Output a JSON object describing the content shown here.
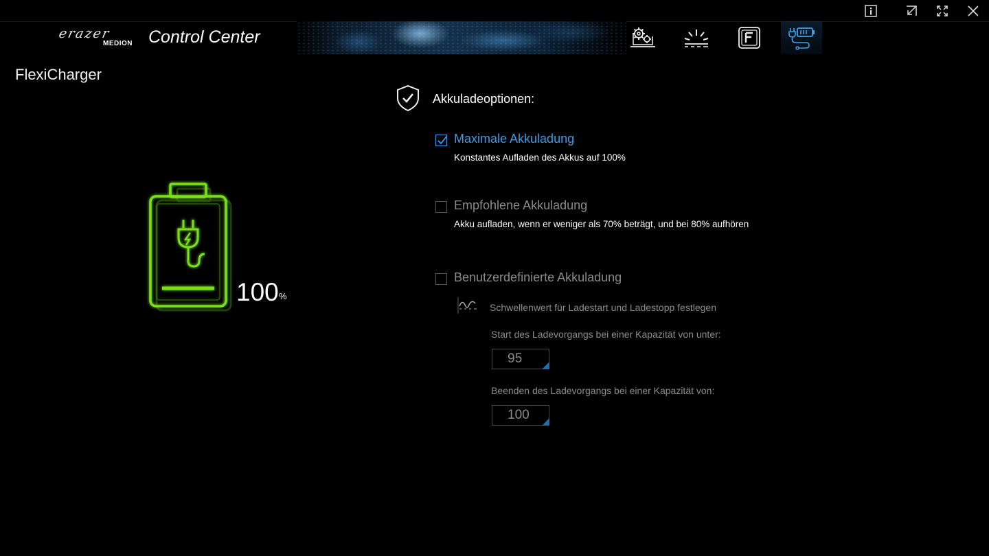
{
  "window": {
    "controls": [
      {
        "name": "info",
        "icon": "info-icon"
      },
      {
        "name": "restore",
        "icon": "shrink-icon"
      },
      {
        "name": "fullscreen",
        "icon": "fullscreen-icon"
      },
      {
        "name": "close",
        "icon": "close-icon"
      }
    ]
  },
  "header": {
    "logo_text": "erazer",
    "logo_sub": "MEDION",
    "app_title": "Control Center",
    "nav": [
      {
        "name": "system-settings",
        "icon": "gear-laptop-icon",
        "active": false
      },
      {
        "name": "lighting",
        "icon": "light-rays-icon",
        "active": false
      },
      {
        "name": "function-key",
        "icon": "f-key-icon",
        "active": false
      },
      {
        "name": "flexicharger",
        "icon": "battery-plug-icon",
        "active": true
      }
    ]
  },
  "page": {
    "title": "FlexiCharger"
  },
  "battery": {
    "percent": "100",
    "unit": "%",
    "color": "#7adf1d"
  },
  "charge_options": {
    "section_title": "Akkuladeoptionen:",
    "options": [
      {
        "label": "Maximale Akkuladung",
        "description": "Konstantes Aufladen des Akkus auf 100%",
        "checked": true
      },
      {
        "label": "Empfohlene Akkuladung",
        "description": "Akku aufladen, wenn er weniger als 70% beträgt, und bei 80% aufhören",
        "checked": false
      },
      {
        "label": "Benutzerdefinierte Akkuladung",
        "checked": false
      }
    ],
    "custom": {
      "threshold_label": "Schwellenwert für Ladestart und Ladestopp festlegen",
      "start_label": "Start des Ladevorgangs bei einer Kapazität von unter:",
      "start_value": "95",
      "stop_label": "Beenden des Ladevorgangs bei einer Kapazität von:",
      "stop_value": "100"
    }
  },
  "colors": {
    "accent": "#3d9be9",
    "battery_green": "#7adf1d",
    "disabled_text": "#8c8c8c"
  }
}
